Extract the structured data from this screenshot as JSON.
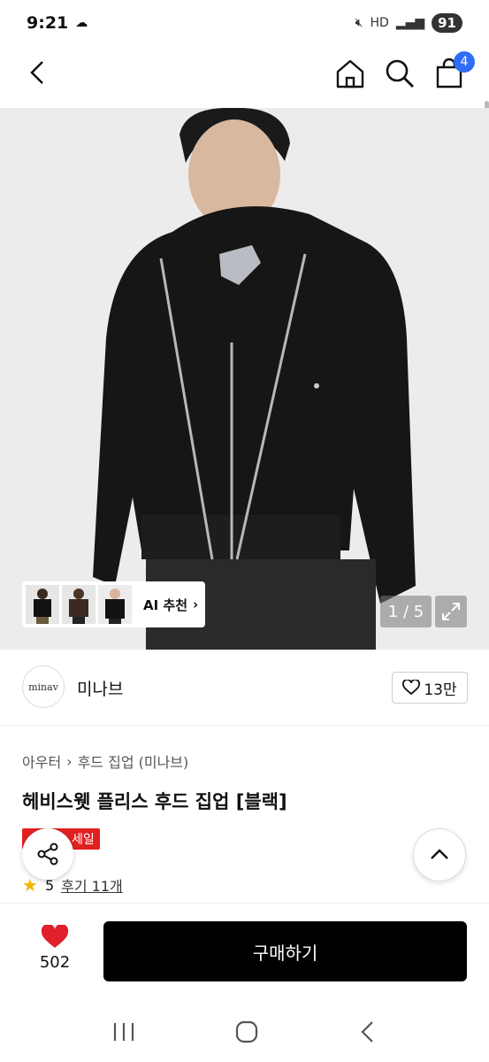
{
  "status": {
    "time": "9:21",
    "battery": "91",
    "network": "HD"
  },
  "header": {
    "cart_count": "4"
  },
  "gallery": {
    "page_indicator": "1 / 5",
    "ai_label": "AI 추천"
  },
  "brand": {
    "logo_text": "minav",
    "name": "미나브",
    "likes": "13만"
  },
  "breadcrumb": {
    "category": "아우터",
    "subcategory": "후드 집업 (미나브)"
  },
  "product": {
    "title": "헤비스웻 플리스 후드 집업 [블랙]",
    "sale_badge": "세일",
    "rating": "5",
    "reviews": "후기 11개"
  },
  "bottom": {
    "wish_count": "502",
    "buy_label": "구매하기"
  },
  "colors": {
    "badge_blue": "#2f6df6",
    "sale_red": "#e02020",
    "heart_red": "#e0202a",
    "star": "#f2b400"
  },
  "icons": [
    "back-arrow-icon",
    "home-icon",
    "search-icon",
    "cart-icon",
    "expand-icon",
    "heart-outline-icon",
    "share-icon",
    "chevron-up-icon",
    "heart-filled-icon",
    "star-icon"
  ]
}
